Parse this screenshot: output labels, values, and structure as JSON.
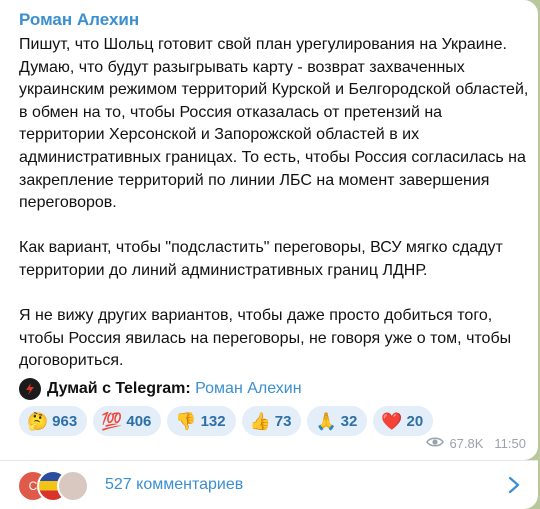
{
  "post": {
    "author": "Роман Алехин",
    "paragraphs": [
      "Пишут, что Шольц готовит свой план урегулирования на Украине. Думаю, что будут разыгрывать карту - возврат захваченных украинским режимом территорий Курской и Белгородской областей, в обмен на то, чтобы Россия отказалась от претензий на территории Херсонской и Запорожской областей в их административных границах. То есть, чтобы Россия согласилась на закрепление территорий по линии ЛБС на момент завершения переговоров.",
      "Как вариант, чтобы \"подсластить\" переговоры, ВСУ мягко сдадут территории до линий административных границ ЛДНР.",
      "Я не вижу других вариантов, чтобы даже просто добиться того, чтобы Россия явилась на переговоры, не говоря уже о том, чтобы договориться."
    ],
    "promo_bold": "Думай с Telegram",
    "promo_separator": ":",
    "promo_link": "Роман Алехин"
  },
  "reactions": [
    {
      "icon": "thinking-face-icon",
      "emoji": "🤔",
      "count": "963"
    },
    {
      "icon": "hundred-points-icon",
      "emoji": "💯",
      "count": "406"
    },
    {
      "icon": "thumbs-down-icon",
      "emoji": "👎",
      "count": "132"
    },
    {
      "icon": "thumbs-up-icon",
      "emoji": "👍",
      "count": "73"
    },
    {
      "icon": "folded-hands-icon",
      "emoji": "🙏",
      "count": "32"
    },
    {
      "icon": "red-heart-icon",
      "emoji": "❤️",
      "count": "20"
    }
  ],
  "meta": {
    "views": "67.8K",
    "time": "11:50"
  },
  "comments": {
    "label": "527 комментариев",
    "first_avatar_letter": "С"
  },
  "colors": {
    "accent": "#3a8fd1",
    "background": "#b9c79c",
    "reaction_bg": "#e3eef8"
  }
}
